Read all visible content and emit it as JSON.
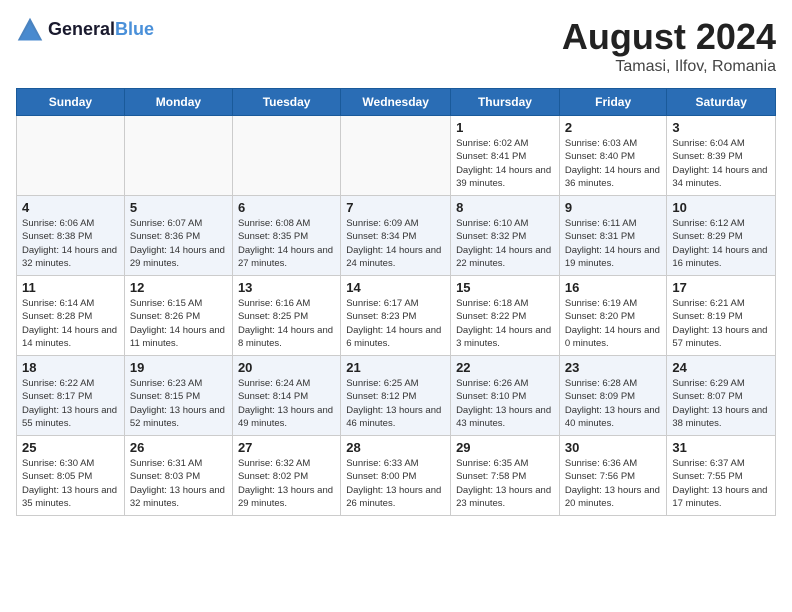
{
  "header": {
    "logo_line1": "General",
    "logo_line2": "Blue",
    "month": "August 2024",
    "location": "Tamasi, Ilfov, Romania"
  },
  "weekdays": [
    "Sunday",
    "Monday",
    "Tuesday",
    "Wednesday",
    "Thursday",
    "Friday",
    "Saturday"
  ],
  "weeks": [
    [
      {
        "day": "",
        "info": ""
      },
      {
        "day": "",
        "info": ""
      },
      {
        "day": "",
        "info": ""
      },
      {
        "day": "",
        "info": ""
      },
      {
        "day": "1",
        "info": "Sunrise: 6:02 AM\nSunset: 8:41 PM\nDaylight: 14 hours\nand 39 minutes."
      },
      {
        "day": "2",
        "info": "Sunrise: 6:03 AM\nSunset: 8:40 PM\nDaylight: 14 hours\nand 36 minutes."
      },
      {
        "day": "3",
        "info": "Sunrise: 6:04 AM\nSunset: 8:39 PM\nDaylight: 14 hours\nand 34 minutes."
      }
    ],
    [
      {
        "day": "4",
        "info": "Sunrise: 6:06 AM\nSunset: 8:38 PM\nDaylight: 14 hours\nand 32 minutes."
      },
      {
        "day": "5",
        "info": "Sunrise: 6:07 AM\nSunset: 8:36 PM\nDaylight: 14 hours\nand 29 minutes."
      },
      {
        "day": "6",
        "info": "Sunrise: 6:08 AM\nSunset: 8:35 PM\nDaylight: 14 hours\nand 27 minutes."
      },
      {
        "day": "7",
        "info": "Sunrise: 6:09 AM\nSunset: 8:34 PM\nDaylight: 14 hours\nand 24 minutes."
      },
      {
        "day": "8",
        "info": "Sunrise: 6:10 AM\nSunset: 8:32 PM\nDaylight: 14 hours\nand 22 minutes."
      },
      {
        "day": "9",
        "info": "Sunrise: 6:11 AM\nSunset: 8:31 PM\nDaylight: 14 hours\nand 19 minutes."
      },
      {
        "day": "10",
        "info": "Sunrise: 6:12 AM\nSunset: 8:29 PM\nDaylight: 14 hours\nand 16 minutes."
      }
    ],
    [
      {
        "day": "11",
        "info": "Sunrise: 6:14 AM\nSunset: 8:28 PM\nDaylight: 14 hours\nand 14 minutes."
      },
      {
        "day": "12",
        "info": "Sunrise: 6:15 AM\nSunset: 8:26 PM\nDaylight: 14 hours\nand 11 minutes."
      },
      {
        "day": "13",
        "info": "Sunrise: 6:16 AM\nSunset: 8:25 PM\nDaylight: 14 hours\nand 8 minutes."
      },
      {
        "day": "14",
        "info": "Sunrise: 6:17 AM\nSunset: 8:23 PM\nDaylight: 14 hours\nand 6 minutes."
      },
      {
        "day": "15",
        "info": "Sunrise: 6:18 AM\nSunset: 8:22 PM\nDaylight: 14 hours\nand 3 minutes."
      },
      {
        "day": "16",
        "info": "Sunrise: 6:19 AM\nSunset: 8:20 PM\nDaylight: 14 hours\nand 0 minutes."
      },
      {
        "day": "17",
        "info": "Sunrise: 6:21 AM\nSunset: 8:19 PM\nDaylight: 13 hours\nand 57 minutes."
      }
    ],
    [
      {
        "day": "18",
        "info": "Sunrise: 6:22 AM\nSunset: 8:17 PM\nDaylight: 13 hours\nand 55 minutes."
      },
      {
        "day": "19",
        "info": "Sunrise: 6:23 AM\nSunset: 8:15 PM\nDaylight: 13 hours\nand 52 minutes."
      },
      {
        "day": "20",
        "info": "Sunrise: 6:24 AM\nSunset: 8:14 PM\nDaylight: 13 hours\nand 49 minutes."
      },
      {
        "day": "21",
        "info": "Sunrise: 6:25 AM\nSunset: 8:12 PM\nDaylight: 13 hours\nand 46 minutes."
      },
      {
        "day": "22",
        "info": "Sunrise: 6:26 AM\nSunset: 8:10 PM\nDaylight: 13 hours\nand 43 minutes."
      },
      {
        "day": "23",
        "info": "Sunrise: 6:28 AM\nSunset: 8:09 PM\nDaylight: 13 hours\nand 40 minutes."
      },
      {
        "day": "24",
        "info": "Sunrise: 6:29 AM\nSunset: 8:07 PM\nDaylight: 13 hours\nand 38 minutes."
      }
    ],
    [
      {
        "day": "25",
        "info": "Sunrise: 6:30 AM\nSunset: 8:05 PM\nDaylight: 13 hours\nand 35 minutes."
      },
      {
        "day": "26",
        "info": "Sunrise: 6:31 AM\nSunset: 8:03 PM\nDaylight: 13 hours\nand 32 minutes."
      },
      {
        "day": "27",
        "info": "Sunrise: 6:32 AM\nSunset: 8:02 PM\nDaylight: 13 hours\nand 29 minutes."
      },
      {
        "day": "28",
        "info": "Sunrise: 6:33 AM\nSunset: 8:00 PM\nDaylight: 13 hours\nand 26 minutes."
      },
      {
        "day": "29",
        "info": "Sunrise: 6:35 AM\nSunset: 7:58 PM\nDaylight: 13 hours\nand 23 minutes."
      },
      {
        "day": "30",
        "info": "Sunrise: 6:36 AM\nSunset: 7:56 PM\nDaylight: 13 hours\nand 20 minutes."
      },
      {
        "day": "31",
        "info": "Sunrise: 6:37 AM\nSunset: 7:55 PM\nDaylight: 13 hours\nand 17 minutes."
      }
    ]
  ]
}
